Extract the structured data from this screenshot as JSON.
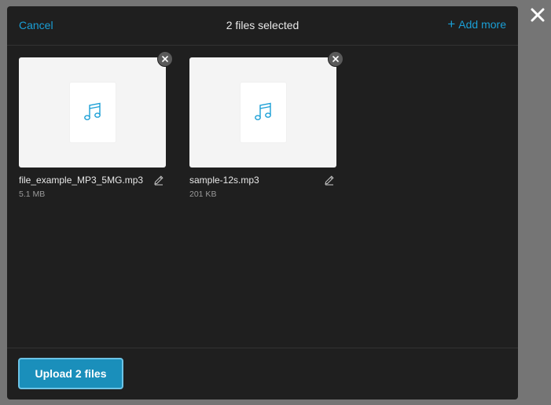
{
  "header": {
    "cancel_label": "Cancel",
    "title": "2 files selected",
    "add_more_label": "Add more"
  },
  "files": [
    {
      "name": "file_example_MP3_5MG.mp3",
      "size": "5.1 MB",
      "icon": "music-note-icon"
    },
    {
      "name": "sample-12s.mp3",
      "size": "201 KB",
      "icon": "music-note-icon"
    }
  ],
  "footer": {
    "upload_label": "Upload 2 files"
  },
  "colors": {
    "accent": "#1a9fd6",
    "upload_button": "#1a8fbb",
    "dialog_bg": "#1f1f1f",
    "backdrop": "#757575"
  }
}
